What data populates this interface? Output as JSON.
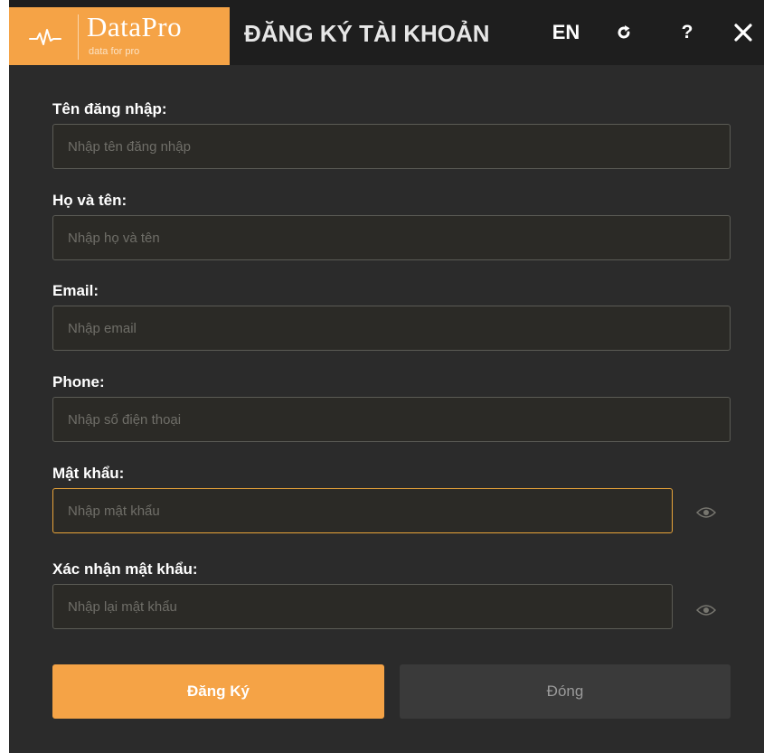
{
  "header": {
    "logo_name": "DataPro",
    "logo_tagline": "data for pro",
    "title": "ĐĂNG KÝ TÀI KHOẢN",
    "language": "EN",
    "help": "?"
  },
  "form": {
    "fields": [
      {
        "label": "Tên đăng nhập:",
        "placeholder": "Nhập tên đăng nhập",
        "value": ""
      },
      {
        "label": "Họ và tên:",
        "placeholder": "Nhập họ và tên",
        "value": ""
      },
      {
        "label": "Email:",
        "placeholder": "Nhập email",
        "value": ""
      },
      {
        "label": "Phone:",
        "placeholder": "Nhập số điện thoại",
        "value": ""
      },
      {
        "label": "Mật khẩu:",
        "placeholder": "Nhập mật khẩu",
        "value": ""
      },
      {
        "label": "Xác nhận mật khẩu:",
        "placeholder": "Nhập lại mật khẩu",
        "value": ""
      }
    ]
  },
  "buttons": {
    "register": "Đăng Ký",
    "close": "Đóng"
  },
  "icons": {
    "logo": "pulse-icon",
    "refresh": "refresh-icon",
    "close": "close-icon",
    "password_toggle": "eye-icon"
  },
  "colors": {
    "accent": "#f5a346",
    "background": "#2b2b2b",
    "titlebar": "#1e1e1e",
    "focus_border": "#e9a43a"
  }
}
